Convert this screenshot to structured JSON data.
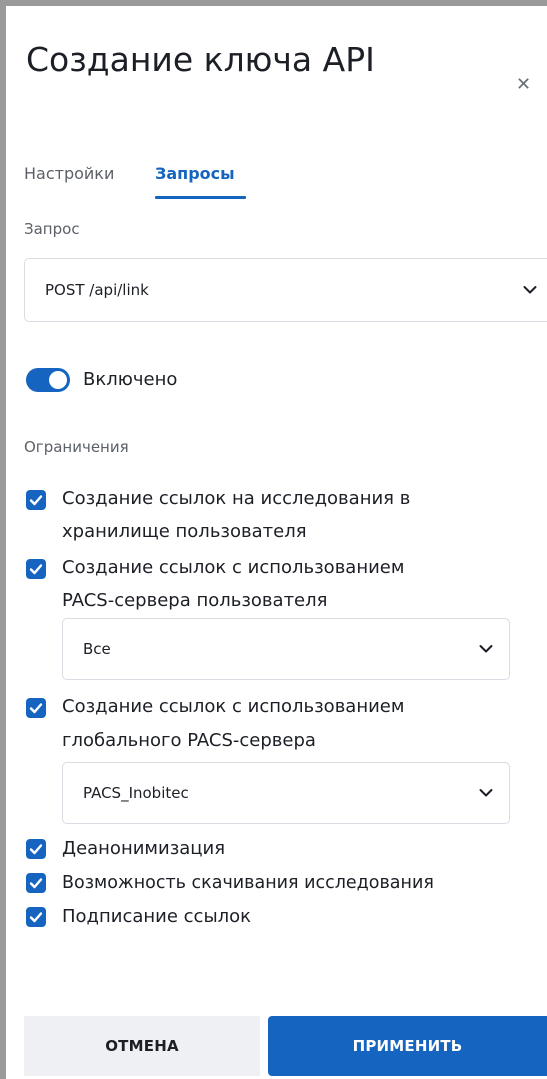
{
  "dialog": {
    "title": "Создание ключа API",
    "close_icon": "close-icon"
  },
  "tabs": [
    {
      "label": "Настройки",
      "active": false
    },
    {
      "label": "Запросы",
      "active": true
    }
  ],
  "request": {
    "label": "Запрос",
    "value": "POST /api/link"
  },
  "enabled": {
    "label": "Включено",
    "on": true
  },
  "restrictions": {
    "label": "Ограничения",
    "items": [
      {
        "line1": "Создание ссылок на исследования в",
        "line2": "хранилище пользователя",
        "checked": true
      },
      {
        "line1": "Создание ссылок с использованием",
        "line2": "PACS-сервера пользователя",
        "checked": true,
        "select_value": "Все"
      },
      {
        "line1": "Создание ссылок с использованием",
        "line2": "глобального PACS-сервера",
        "checked": true,
        "select_value": "PACS_Inobitec"
      },
      {
        "line1": "Деанонимизация",
        "checked": true
      },
      {
        "line1": "Возможность скачивания исследования",
        "checked": true
      },
      {
        "line1": "Подписание ссылок",
        "checked": true
      }
    ]
  },
  "buttons": {
    "cancel": "ОТМЕНА",
    "apply": "ПРИМЕНИТЬ"
  },
  "colors": {
    "accent": "#1565c0",
    "frame": "#9a9a9a"
  }
}
